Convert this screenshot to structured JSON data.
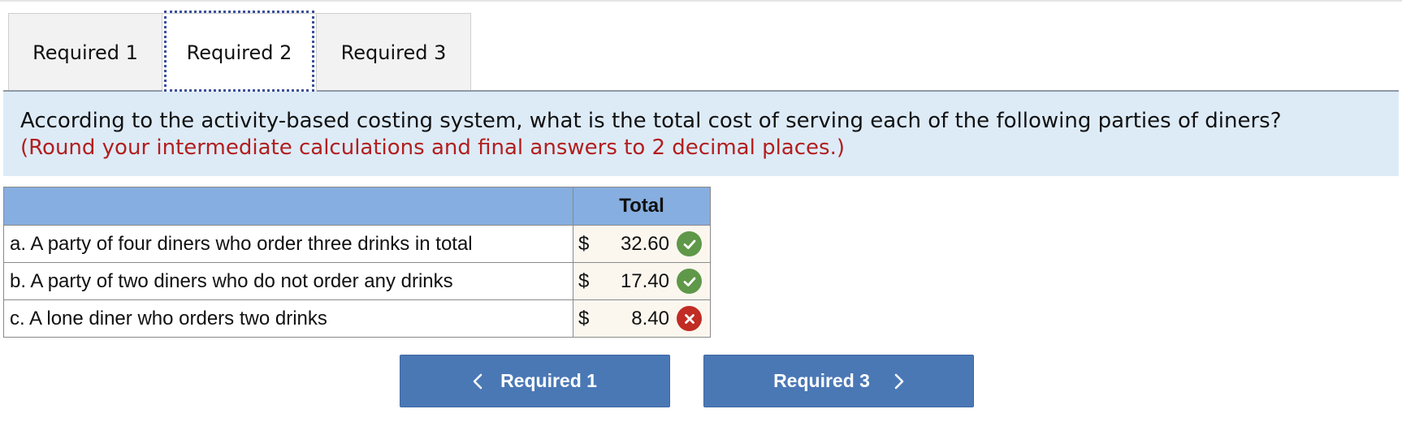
{
  "tabs": [
    {
      "label": "Required 1",
      "active": false
    },
    {
      "label": "Required 2",
      "active": true
    },
    {
      "label": "Required 3",
      "active": false
    }
  ],
  "question": {
    "prompt": "According to the activity-based costing system, what is the total cost of serving each of the following parties of diners?",
    "note": "(Round your intermediate calculations and final answers to 2 decimal places.)"
  },
  "table": {
    "column_header": "Total",
    "rows": [
      {
        "label": "a. A party of four diners who order three drinks in total",
        "currency": "$",
        "value": "32.60",
        "status": "correct"
      },
      {
        "label": "b. A party of two diners who do not order any drinks",
        "currency": "$",
        "value": "17.40",
        "status": "correct"
      },
      {
        "label": "c. A lone diner who orders two drinks",
        "currency": "$",
        "value": "8.40",
        "status": "incorrect"
      }
    ]
  },
  "navigation": {
    "prev_label": "Required 1",
    "next_label": "Required 3"
  },
  "colors": {
    "question_bg": "#ddebf7",
    "note_text": "#b21e1e",
    "table_header_bg": "#86aee0",
    "button_bg": "#4a78b5",
    "correct": "#5f9848",
    "incorrect": "#c12c24"
  },
  "icons": {
    "correct": "check-circle-icon",
    "incorrect": "x-circle-icon",
    "prev": "chevron-left-icon",
    "next": "chevron-right-icon"
  }
}
